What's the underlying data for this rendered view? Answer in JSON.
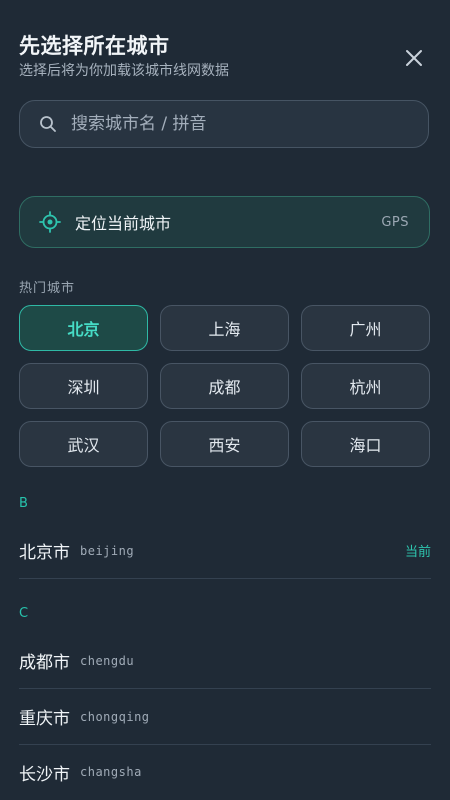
{
  "header": {
    "title": "先选择所在城市",
    "subtitle": "选择后将为你加载该城市线网数据"
  },
  "search": {
    "placeholder": "搜索城市名 / 拼音"
  },
  "locate": {
    "label": "定位当前城市",
    "badge": "GPS"
  },
  "hot": {
    "title": "热门城市",
    "cities": [
      "北京",
      "上海",
      "广州",
      "深圳",
      "成都",
      "杭州",
      "武汉",
      "西安",
      "海口"
    ],
    "selected": "北京"
  },
  "sections": [
    {
      "letter": "B",
      "cities": [
        {
          "name": "北京市",
          "pinyin": "beijing",
          "tag": "当前"
        }
      ]
    },
    {
      "letter": "C",
      "cities": [
        {
          "name": "成都市",
          "pinyin": "chengdu"
        },
        {
          "name": "重庆市",
          "pinyin": "chongqing"
        },
        {
          "name": "长沙市",
          "pinyin": "changsha"
        }
      ]
    }
  ],
  "colors": {
    "background": "#1f2a36",
    "accent": "#2ec5af"
  }
}
